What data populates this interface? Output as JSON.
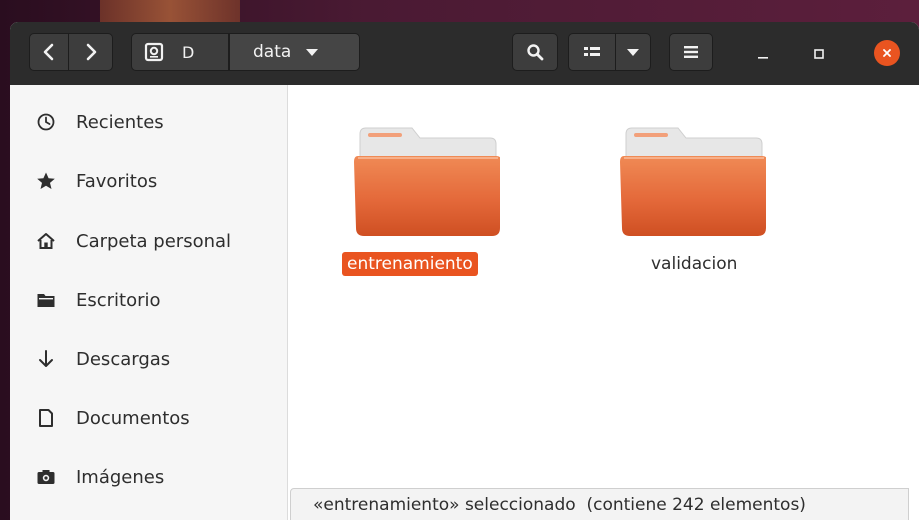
{
  "header": {
    "drive_label": "D",
    "current_folder": "data"
  },
  "sidebar": {
    "items": [
      {
        "label": "Recientes",
        "icon": "clock-icon"
      },
      {
        "label": "Favoritos",
        "icon": "star-icon"
      },
      {
        "label": "Carpeta personal",
        "icon": "home-icon"
      },
      {
        "label": "Escritorio",
        "icon": "folder-icon"
      },
      {
        "label": "Descargas",
        "icon": "download-arrow-icon"
      },
      {
        "label": "Documentos",
        "icon": "document-icon"
      },
      {
        "label": "Imágenes",
        "icon": "camera-icon"
      }
    ]
  },
  "content": {
    "folders": [
      {
        "name": "entrenamiento",
        "selected": true
      },
      {
        "name": "validacion",
        "selected": false
      }
    ]
  },
  "status": {
    "text": "«entrenamiento» seleccionado  (contiene 242 elementos)"
  },
  "colors": {
    "accent": "#e95420",
    "headerbar": "#2c2c2c",
    "folder_orange": "#e4693a"
  }
}
